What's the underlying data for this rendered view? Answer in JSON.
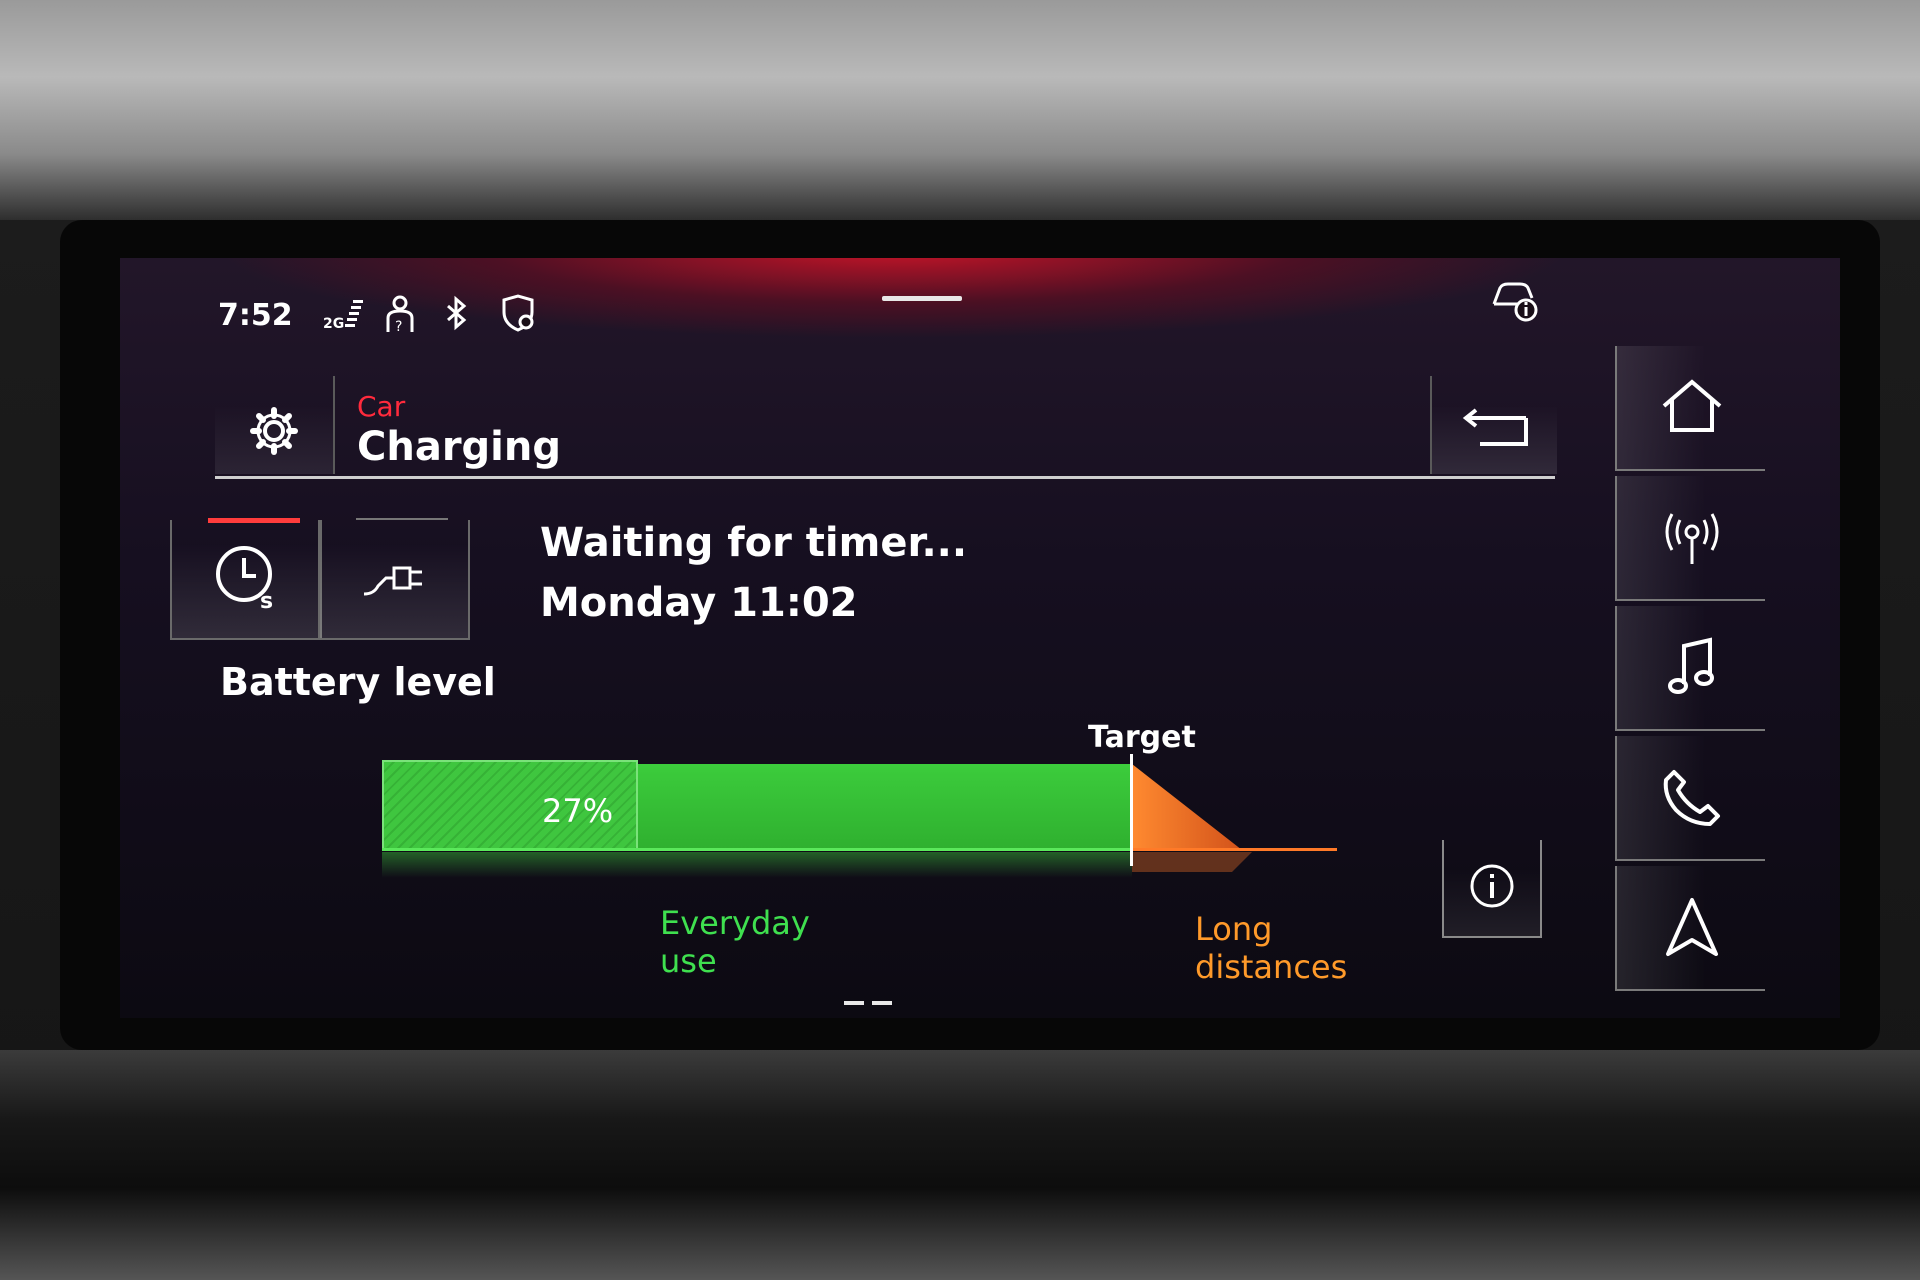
{
  "status_bar": {
    "time": "7:52",
    "signal_label": "2G",
    "icons": [
      "signal-2g-icon",
      "person-help-icon",
      "bluetooth-icon",
      "shield-location-icon",
      "car-info-icon"
    ]
  },
  "header": {
    "breadcrumb": "Car",
    "title": "Charging",
    "settings_icon": "gear-icon",
    "back_icon": "back-arrow-icon"
  },
  "modes": [
    {
      "icon": "clock-timer-icon",
      "active": true
    },
    {
      "icon": "plug-icon",
      "active": false
    }
  ],
  "charging_status": {
    "line1": "Waiting for timer...",
    "line2": "Monday 11:02"
  },
  "battery": {
    "label": "Battery level",
    "current_percent_text": "27%",
    "current_level": 27,
    "target_label": "Target",
    "zone_everyday": [
      "Everyday",
      "use"
    ],
    "zone_long": [
      "Long",
      "distances"
    ]
  },
  "side_nav": [
    "home-icon",
    "radio-icon",
    "music-icon",
    "phone-icon",
    "navigation-icon"
  ],
  "colors": {
    "accent_red": "#ff2a3c",
    "battery_green": "#3ccc3c",
    "long_distance_orange": "#ff7a28"
  }
}
